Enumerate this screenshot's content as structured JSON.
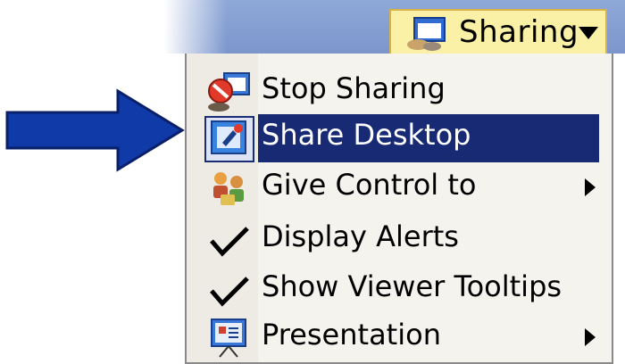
{
  "toolbar": {
    "sharing_button": {
      "label": "Sharing",
      "icon": "share-session-icon",
      "dropdown_icon": "chevron-down-icon"
    }
  },
  "menu": {
    "items": [
      {
        "label": "Stop Sharing",
        "icon": "stop-sharing-icon",
        "selected": false
      },
      {
        "label": "Share Desktop",
        "icon": "share-desktop-icon",
        "selected": true
      },
      {
        "label": "Give Control to",
        "icon": "give-control-icon",
        "submenu": true
      },
      {
        "label": "Display Alerts",
        "icon": "checkmark-icon",
        "checked": true
      },
      {
        "label": "Show Viewer Tooltips",
        "icon": "checkmark-icon",
        "checked": true
      },
      {
        "label": "Presentation",
        "icon": "presentation-icon",
        "submenu": true
      }
    ]
  },
  "annotation": {
    "icon": "pointer-arrow-icon",
    "color": "#0f3aa8"
  },
  "colors": {
    "highlight": "#172a73",
    "button_bg": "#fbf1a6",
    "toolbar_bg": "#8fa8d8"
  }
}
